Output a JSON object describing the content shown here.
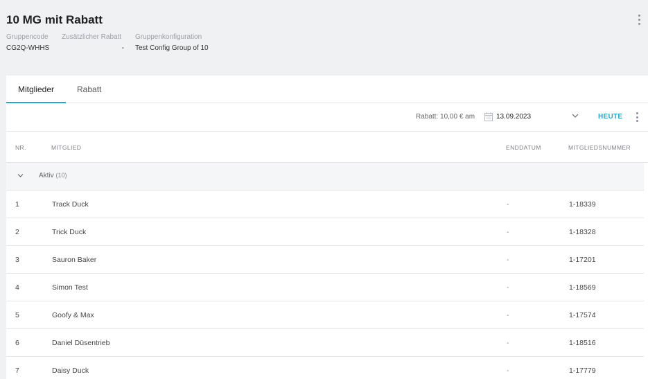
{
  "header": {
    "title": "10 MG mit Rabatt",
    "fields": [
      {
        "label": "Gruppencode",
        "value": "CG2Q-WHHS"
      },
      {
        "label": "Zusätzlicher Rabatt",
        "value": "-"
      },
      {
        "label": "Gruppenkonfiguration",
        "value": "Test Config Group of 10"
      }
    ]
  },
  "tabs": [
    {
      "label": "Mitglieder",
      "active": true
    },
    {
      "label": "Rabatt",
      "active": false
    }
  ],
  "toolbar": {
    "rabatt_label": "Rabatt: 10,00 € am",
    "date": "13.09.2023",
    "today_label": "HEUTE"
  },
  "table": {
    "columns": [
      "NR.",
      "MITGLIED",
      "ENDDATUM",
      "MITGLIEDSNUMMER"
    ],
    "group": {
      "label": "Aktiv",
      "count": "(10)"
    },
    "rows": [
      {
        "nr": "1",
        "name": "Track Duck",
        "end": "-",
        "number": "1-18339"
      },
      {
        "nr": "2",
        "name": "Trick Duck",
        "end": "-",
        "number": "1-18328"
      },
      {
        "nr": "3",
        "name": "Sauron Baker",
        "end": "-",
        "number": "1-17201"
      },
      {
        "nr": "4",
        "name": "Simon Test",
        "end": "-",
        "number": "1-18569"
      },
      {
        "nr": "5",
        "name": "Goofy & Max",
        "end": "-",
        "number": "1-17574"
      },
      {
        "nr": "6",
        "name": "Daniel Düsentrieb",
        "end": "-",
        "number": "1-18516"
      },
      {
        "nr": "7",
        "name": "Daisy Duck",
        "end": "-",
        "number": "1-17779"
      }
    ]
  },
  "colors": {
    "accent": "#2aa7c7",
    "background": "#f0f1f3"
  },
  "icons": [
    "kebab-menu-icon",
    "calendar-icon",
    "chevron-down-icon"
  ]
}
